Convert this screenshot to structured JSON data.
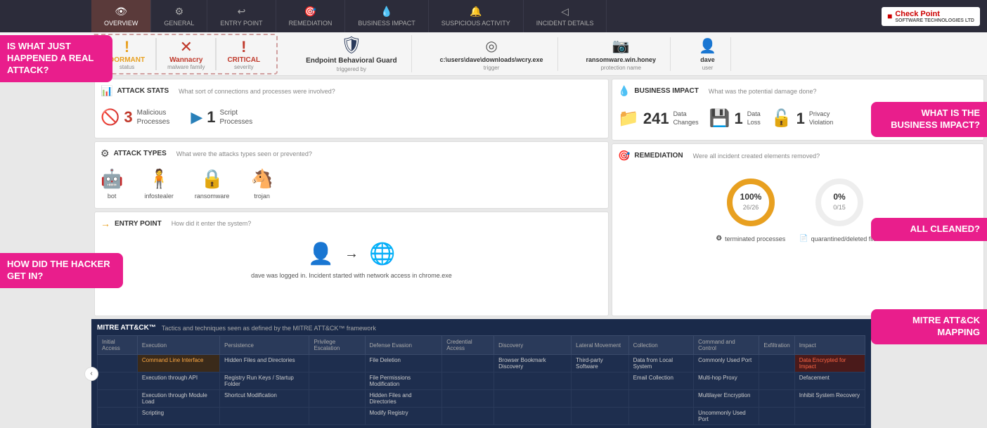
{
  "nav": {
    "items": [
      {
        "label": "OVERVIEW",
        "icon": "👁",
        "active": true
      },
      {
        "label": "GENERAL",
        "icon": "⚙"
      },
      {
        "label": "ENTRY POINT",
        "icon": "↩"
      },
      {
        "label": "REMEDIATION",
        "icon": "🎯"
      },
      {
        "label": "BUSINESS IMPACT",
        "icon": "💧"
      },
      {
        "label": "SUSPICIOUS ACTIVITY",
        "icon": "🔔"
      },
      {
        "label": "INCIDENT DETAILS",
        "icon": "◁"
      }
    ],
    "brand": "Check Point",
    "brand_sub": "SOFTWARE TECHNOLOGIES LTD"
  },
  "header": {
    "status_items": [
      {
        "icon": "!",
        "color": "dormant",
        "value": "DORMANT",
        "label": "status"
      },
      {
        "icon": "✕",
        "color": "wannacry",
        "value": "Wannacry",
        "label": "malware family"
      },
      {
        "icon": "!",
        "color": "critical",
        "value": "CRITICAL",
        "label": "severity"
      }
    ],
    "trigger": {
      "icon": "🛡",
      "value": "Endpoint Behavioral Guard",
      "label": "triggered by"
    },
    "details": [
      {
        "icon": "◎",
        "value": "c:\\users\\dave\\downloads\\wcry.exe",
        "label": "trigger"
      },
      {
        "icon": "📷",
        "value": "ransomware.win.honey",
        "label": "protection name"
      },
      {
        "icon": "👤",
        "value": "dave",
        "label": "user"
      }
    ]
  },
  "callouts": {
    "top_left": "IS WHAT JUST HAPPENED A REAL ATTACK?",
    "mid_left": "HOW DID THE HACKER GET IN?",
    "right_top": "WHAT IS THE BUSINESS IMPACT?",
    "right_mid": "ALL CLEANED?",
    "right_bot": "MITRE ATT&CK MAPPING"
  },
  "attack_stats": {
    "title": "ATTACK STATS",
    "question": "What sort of connections and processes were involved?",
    "items": [
      {
        "count": "3",
        "label": "Malicious\nProcesses",
        "icon": "🚫"
      },
      {
        "count": "1",
        "label": "Script\nProcesses",
        "icon": "▶"
      }
    ]
  },
  "attack_types": {
    "title": "ATTACK TYPES",
    "question": "What were the attacks types seen or prevented?",
    "items": [
      {
        "icon": "🤖",
        "label": "bot"
      },
      {
        "icon": "🧍",
        "label": "infostealer"
      },
      {
        "icon": "🔒",
        "label": "ransomware"
      },
      {
        "icon": "🐴",
        "label": "trojan"
      }
    ]
  },
  "entry_point": {
    "title": "ENTRY POINT",
    "question": "How did it enter the system?",
    "description": "dave was logged in. Incident started with network access in chrome.exe"
  },
  "business_impact": {
    "title": "BUSINESS IMPACT",
    "question": "What was the potential damage done?",
    "items": [
      {
        "icon": "📁",
        "count": "241",
        "label": "Data\nChanges"
      },
      {
        "icon": "💾",
        "count": "1",
        "label": "Data\nLoss"
      },
      {
        "icon": "🔓",
        "count": "1",
        "label": "Privacy\nViolation"
      }
    ]
  },
  "remediation": {
    "title": "REMEDIATION",
    "question": "Were all incident created elements removed?",
    "items": [
      {
        "percent": "100%",
        "fraction": "26/26",
        "label": "terminated processes",
        "color_arc": "#e8a020",
        "bg_color": "#f5f5f5"
      },
      {
        "percent": "0%",
        "fraction": "0/15",
        "label": "quarantined/deleted files",
        "color_arc": "#e8a020",
        "bg_color": "#f5f5f5"
      }
    ]
  },
  "mitre": {
    "title": "MITRE ATT&CK™",
    "subtitle": "Tactics and techniques seen as defined by the MITRE ATT&CK™ framework",
    "columns": [
      "Initial Access",
      "Execution",
      "Persistence",
      "Privilege Escalation",
      "Defense Evasion",
      "Credential Access",
      "Discovery",
      "Lateral Movement",
      "Collection",
      "Command and Control",
      "Exfiltration",
      "Impact"
    ],
    "rows": [
      [
        "",
        "Command Line Interface",
        "Hidden Files and Directories",
        "",
        "File Deletion",
        "",
        "Browser Bookmark Discovery",
        "Third-party Software",
        "Data from Local System",
        "Commonly Used Port",
        "",
        "Data Encrypted for Impact"
      ],
      [
        "",
        "Execution through API",
        "Registry Run Keys / Startup Folder",
        "",
        "File Permissions Modification",
        "",
        "",
        "",
        "Email Collection",
        "Multi-hop Proxy",
        "",
        "Defacement"
      ],
      [
        "",
        "Execution through Module Load",
        "Shortcut Modification",
        "",
        "Hidden Files and Directories",
        "",
        "",
        "",
        "",
        "Multilayer Encryption",
        "",
        "Inhibit System Recovery"
      ],
      [
        "",
        "Scripting",
        "",
        "",
        "Modify Registry",
        "",
        "",
        "",
        "",
        "Uncommonly Used Port",
        "",
        ""
      ]
    ]
  }
}
